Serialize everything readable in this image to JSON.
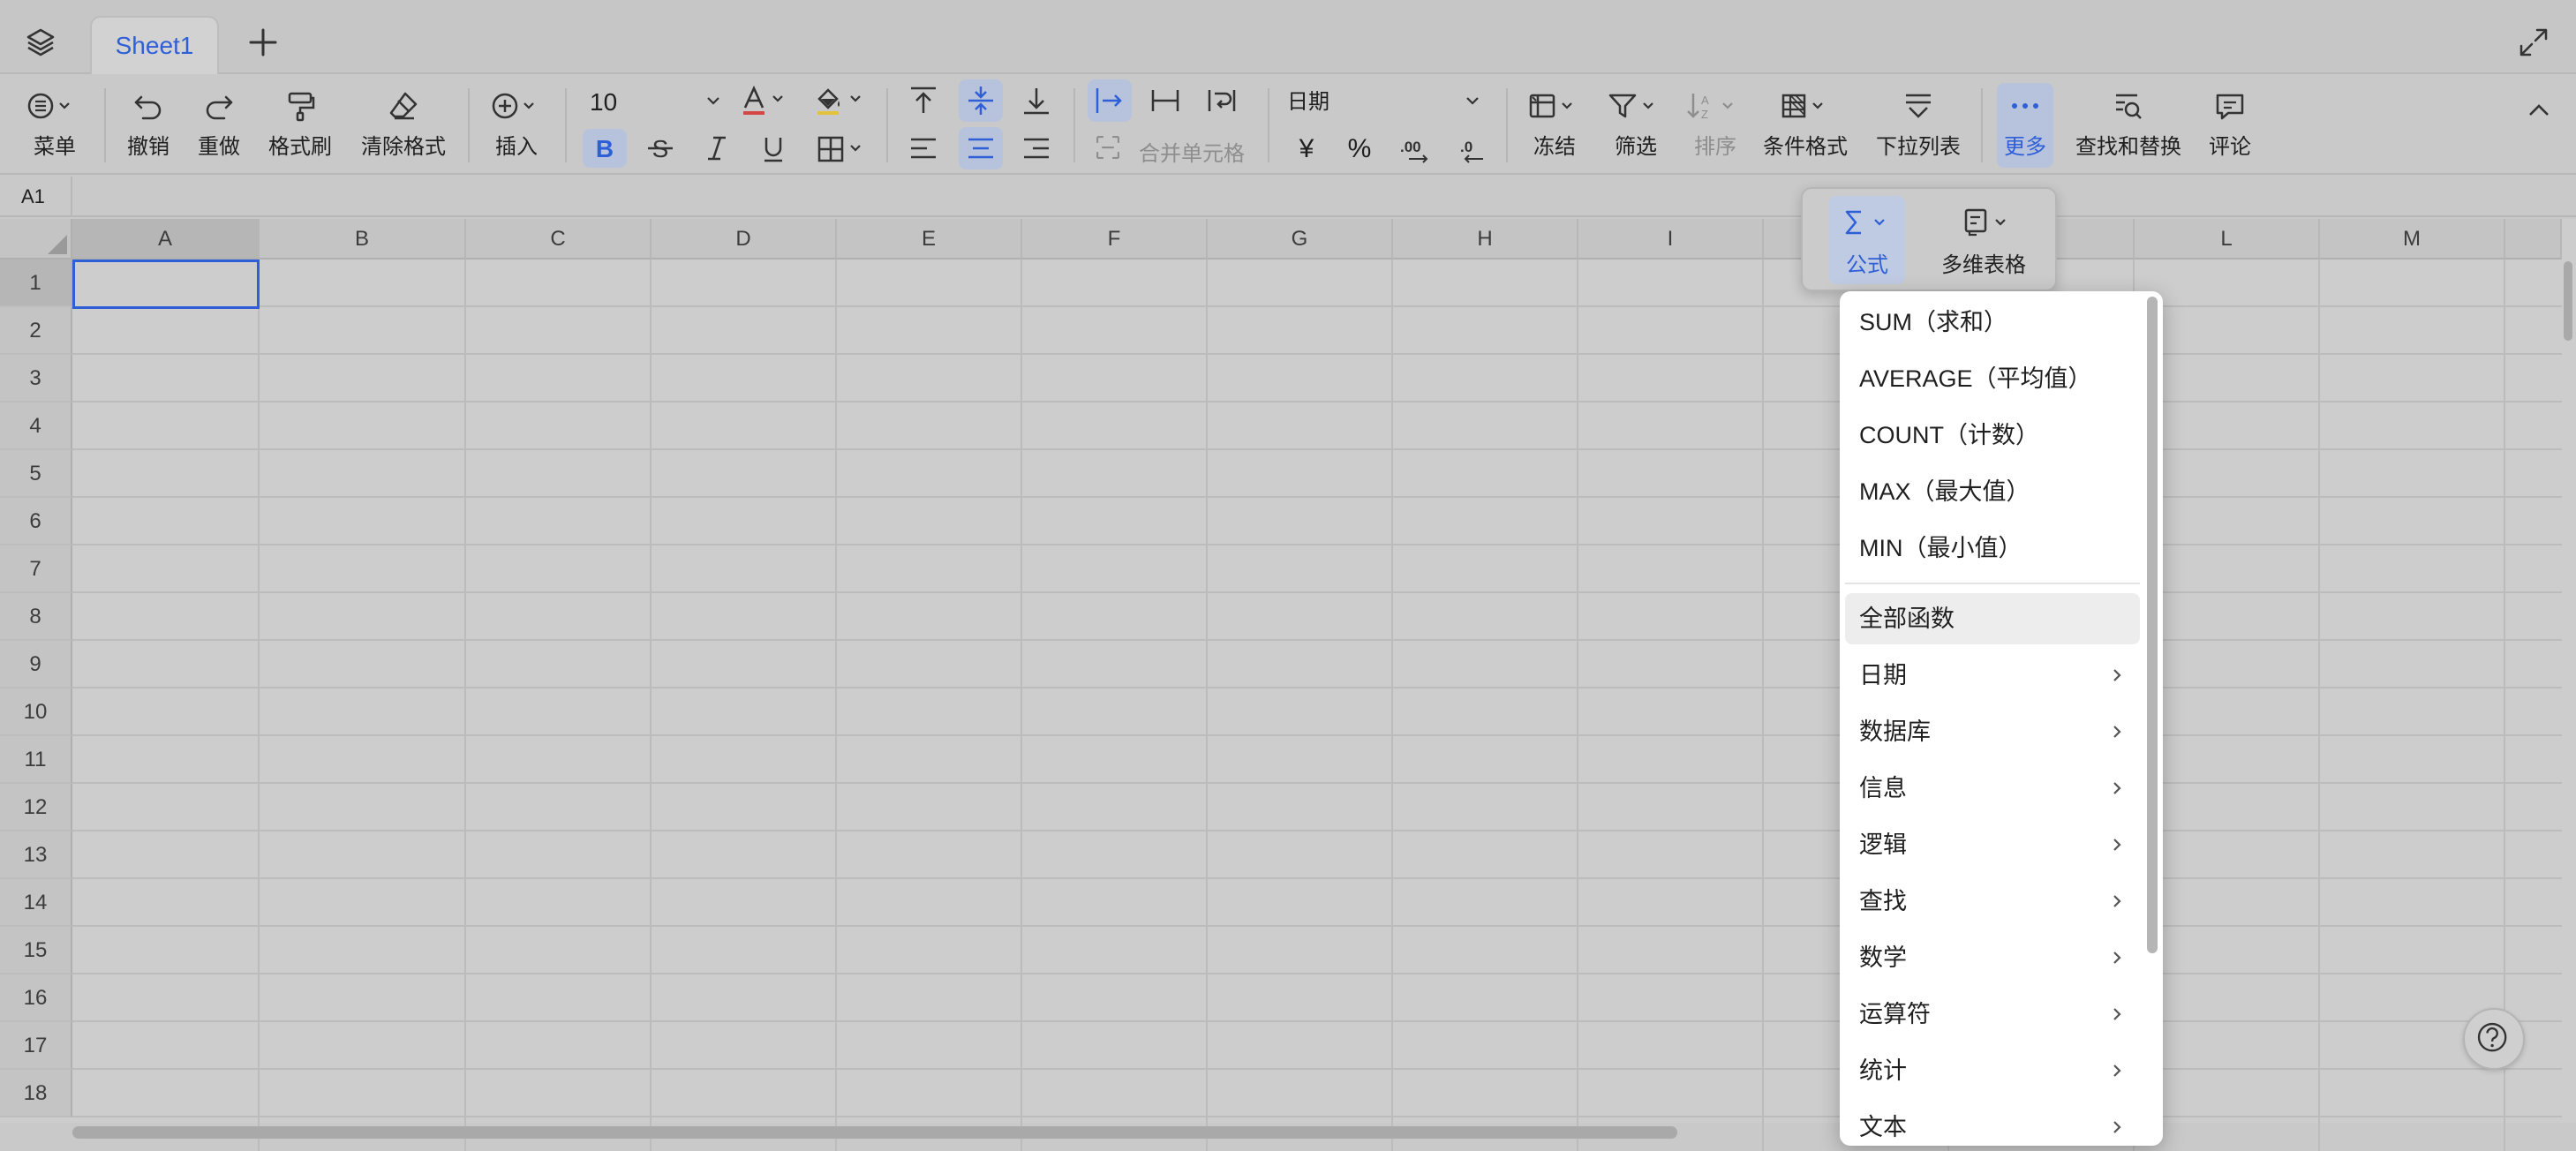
{
  "tabs": {
    "sheet_name": "Sheet1"
  },
  "toolbar": {
    "menu": "菜单",
    "undo": "撤销",
    "redo": "重做",
    "format_painter": "格式刷",
    "clear_format": "清除格式",
    "insert": "插入",
    "font_size": "10",
    "merge_cells": "合并单元格",
    "number_format": "日期",
    "currency_symbol": "¥",
    "percent_symbol": "%",
    "freeze": "冻结",
    "filter": "筛选",
    "sort": "排序",
    "conditional_format": "条件格式",
    "dropdown_list": "下拉列表",
    "more": "更多",
    "find_replace": "查找和替换",
    "comment": "评论"
  },
  "name_box": {
    "cell_ref": "A1"
  },
  "grid": {
    "columns": [
      "A",
      "B",
      "C",
      "D",
      "E",
      "F",
      "G",
      "H",
      "I",
      "",
      "",
      "L",
      "M"
    ],
    "rows": [
      "1",
      "2",
      "3",
      "4",
      "5",
      "6",
      "7",
      "8",
      "9",
      "10",
      "11",
      "12",
      "13",
      "14",
      "15",
      "16",
      "17",
      "18"
    ]
  },
  "more_popover": {
    "formula": "公式",
    "multi_table": "多维表格"
  },
  "formula_menu": {
    "quick_functions": [
      "SUM（求和）",
      "AVERAGE（平均值）",
      "COUNT（计数）",
      "MAX（最大值）",
      "MIN（最小值）"
    ],
    "all_functions": "全部函数",
    "categories": [
      "日期",
      "数据库",
      "信息",
      "逻辑",
      "查找",
      "数学",
      "运算符",
      "统计",
      "文本"
    ]
  },
  "colors": {
    "accent": "#2f5fd6",
    "overlay": "#c9c9c9",
    "menu_bg": "#ffffff"
  }
}
